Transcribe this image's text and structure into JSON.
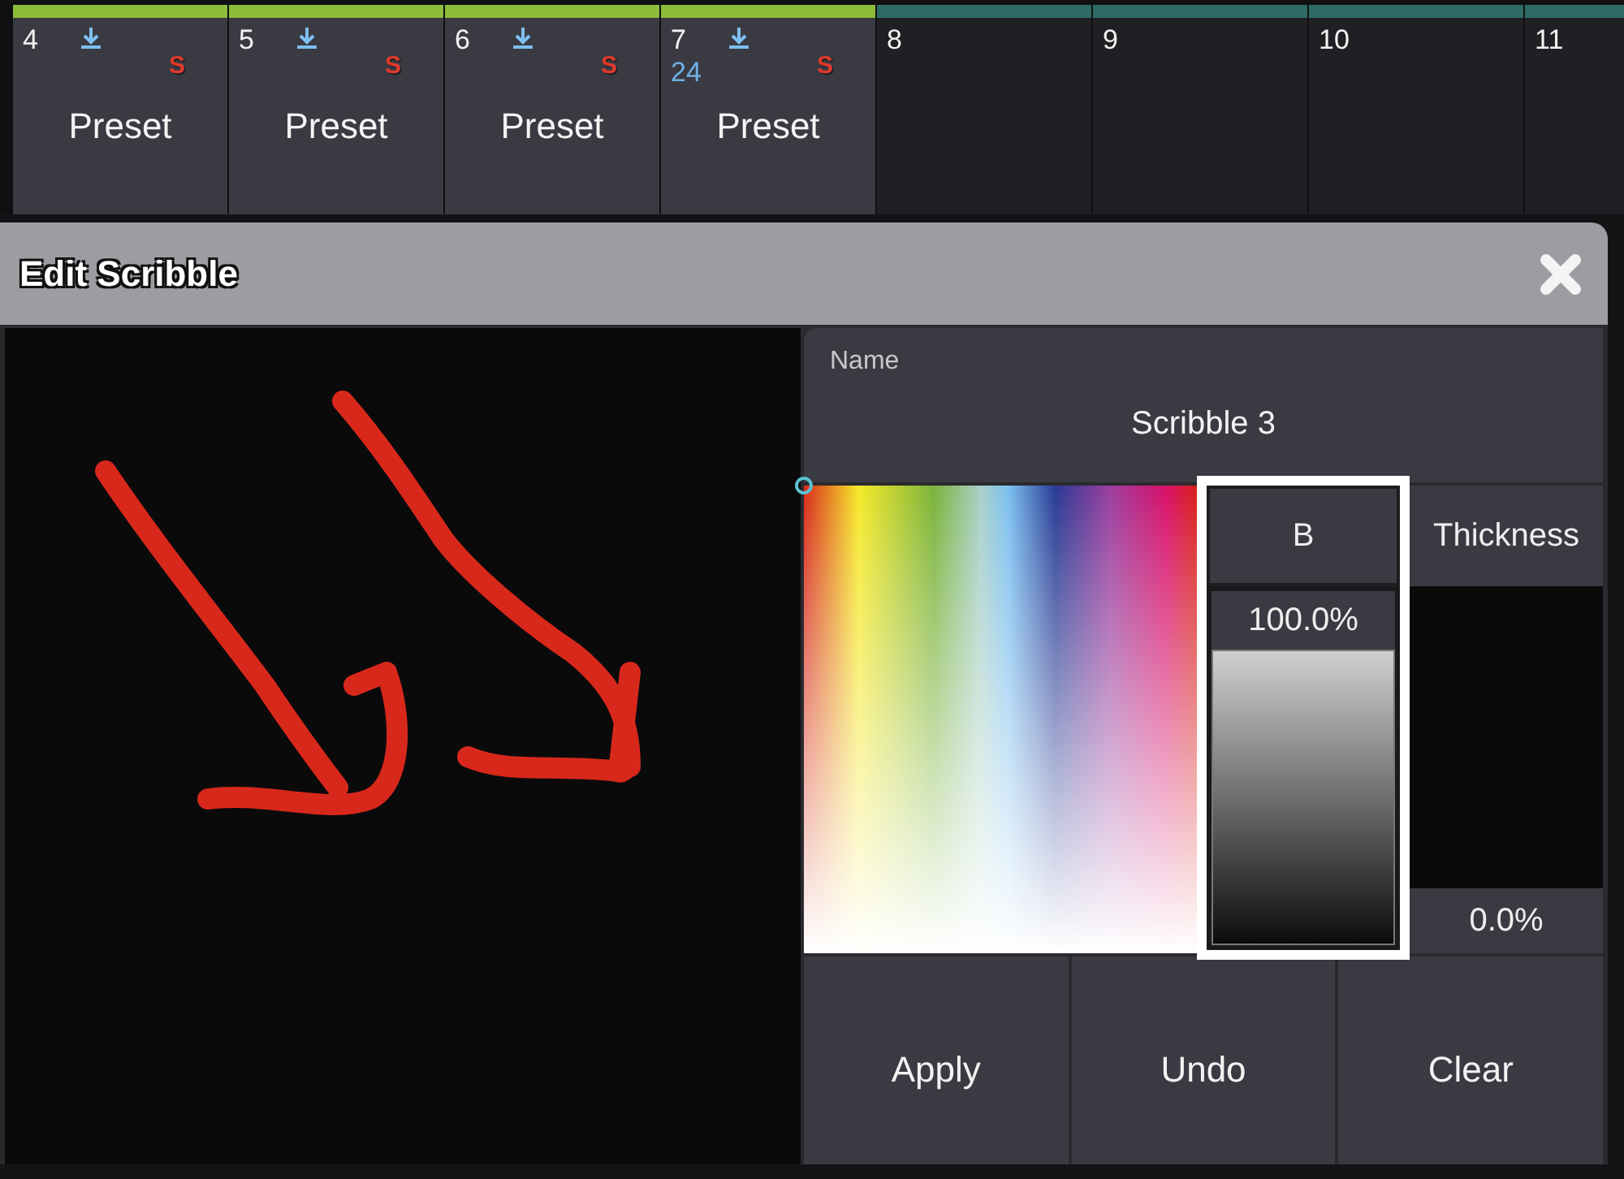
{
  "tiles": [
    {
      "number": "4",
      "kind": "preset",
      "color": "#8dbb3a",
      "flag": "S",
      "label": "Preset"
    },
    {
      "number": "5",
      "kind": "preset",
      "color": "#8dbb3a",
      "flag": "S",
      "label": "Preset"
    },
    {
      "number": "6",
      "kind": "preset",
      "color": "#8dbb3a",
      "flag": "S",
      "label": "Preset"
    },
    {
      "number": "7",
      "kind": "preset",
      "color": "#8dbb3a",
      "count": "24",
      "flag": "S",
      "label": "Preset"
    },
    {
      "number": "8",
      "kind": "empty",
      "color": "#2f6b66"
    },
    {
      "number": "9",
      "kind": "empty",
      "color": "#2f6b66"
    },
    {
      "number": "10",
      "kind": "empty",
      "color": "#2f6b66"
    },
    {
      "number": "11",
      "kind": "empty",
      "color": "#2f6b66"
    }
  ],
  "dialog": {
    "title": "Edit Scribble",
    "name_field": {
      "label": "Name",
      "value": "Scribble 3"
    },
    "brightness": {
      "label": "B",
      "reading": "100.0%",
      "level": 1.0
    },
    "thickness": {
      "label": "Thickness",
      "reading": "0.0%",
      "level": 0.0
    },
    "buttons": [
      "Apply",
      "Undo",
      "Clear"
    ]
  }
}
